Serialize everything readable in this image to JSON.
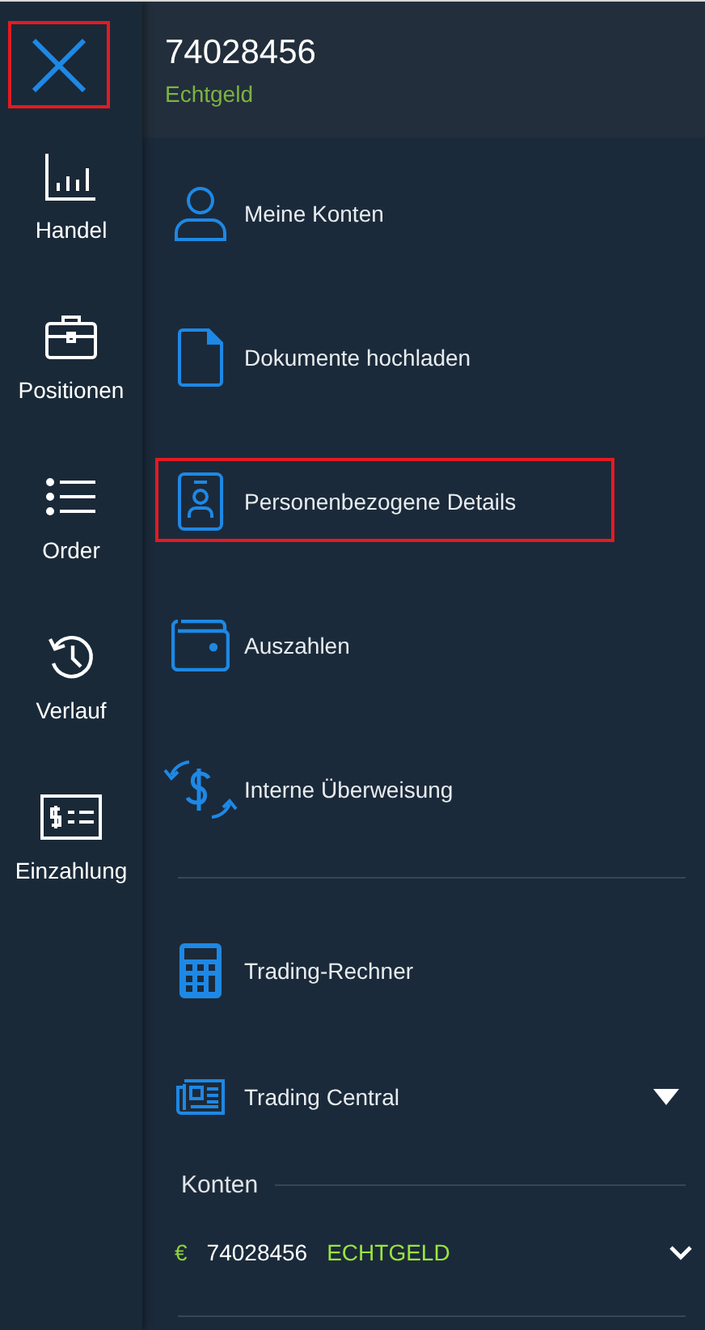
{
  "close_button": {
    "highlighted": true
  },
  "rail": [
    {
      "label": "Handel"
    },
    {
      "label": "Positionen"
    },
    {
      "label": "Order"
    },
    {
      "label": "Verlauf"
    },
    {
      "label": "Einzahlung"
    }
  ],
  "header": {
    "account_number": "74028456",
    "account_type": "Echtgeld"
  },
  "menu": [
    {
      "label": "Meine Konten",
      "highlighted": false
    },
    {
      "label": "Dokumente hochladen",
      "highlighted": false
    },
    {
      "label": "Personenbezogene Details",
      "highlighted": true
    },
    {
      "label": "Auszahlen",
      "highlighted": false
    },
    {
      "label": "Interne Überweisung",
      "highlighted": false
    }
  ],
  "tools": [
    {
      "label": "Trading-Rechner",
      "kind": "link"
    },
    {
      "label": "Trading Central",
      "kind": "dropdown",
      "expanded": false
    }
  ],
  "accounts": {
    "heading": "Konten",
    "items": [
      {
        "currency": "€",
        "number": "74028456",
        "type": "ECHTGELD",
        "expanded": false
      }
    ]
  }
}
